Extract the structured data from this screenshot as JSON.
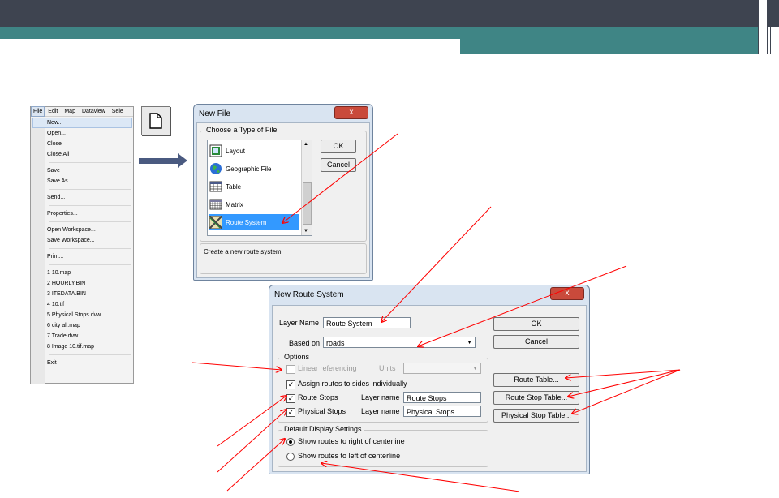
{
  "colors": {
    "header_dark": "#3e4450",
    "teal": "#3f8585",
    "annotation_red": "#ff0000",
    "arrow_blue": "#4a5a80",
    "selection_blue": "#3399ff"
  },
  "file_menu": {
    "menubar": [
      "File",
      "Edit",
      "Map",
      "Dataview",
      "Sele"
    ],
    "groups": [
      [
        "New...",
        "Open...",
        "Close",
        "Close All"
      ],
      [
        "Save",
        "Save As..."
      ],
      [
        "Send..."
      ],
      [
        "Properties..."
      ],
      [
        "Open Workspace...",
        "Save Workspace..."
      ],
      [
        "Print..."
      ],
      [
        "1 10.map",
        "2 HOURLY.BIN",
        "3 ITEDATA.BIN",
        "4 10.tif",
        "5 Physical Stops.dvw",
        "6 city all.map",
        "7 Trade.dvw",
        "8 Image 10.tif.map"
      ],
      [
        "Exit"
      ]
    ]
  },
  "new_icon": "new-document-icon",
  "new_file": {
    "title": "New File",
    "close": "x",
    "group_label": "Choose a Type of File",
    "items": [
      {
        "label": "Layout",
        "icon": "layout-icon"
      },
      {
        "label": "Geographic File",
        "icon": "globe-icon"
      },
      {
        "label": "Table",
        "icon": "table-icon"
      },
      {
        "label": "Matrix",
        "icon": "matrix-icon"
      },
      {
        "label": "Route System",
        "icon": "route-system-icon"
      }
    ],
    "selected": "Route System",
    "ok": "OK",
    "cancel": "Cancel",
    "status": "Create a new route system"
  },
  "new_route": {
    "title": "New Route System",
    "close": "x",
    "layer_name_label": "Layer Name",
    "layer_name_value": "Route System",
    "based_on_label": "Based on",
    "based_on_value": "roads",
    "ok": "OK",
    "cancel": "Cancel",
    "options_label": "Options",
    "linear_ref": "Linear referencing",
    "units_label": "Units",
    "assign_sides": "Assign routes to sides individually",
    "route_stops": "Route Stops",
    "layer_name_short": "Layer name",
    "route_stops_value": "Route Stops",
    "physical_stops": "Physical Stops",
    "physical_stops_value": "Physical Stops",
    "route_table": "Route Table...",
    "route_stop_table": "Route Stop Table...",
    "physical_stop_table": "Physical Stop Table...",
    "display_label": "Default Display Settings",
    "show_right": "Show routes to right of centerline",
    "show_left": "Show routes to left of centerline"
  }
}
